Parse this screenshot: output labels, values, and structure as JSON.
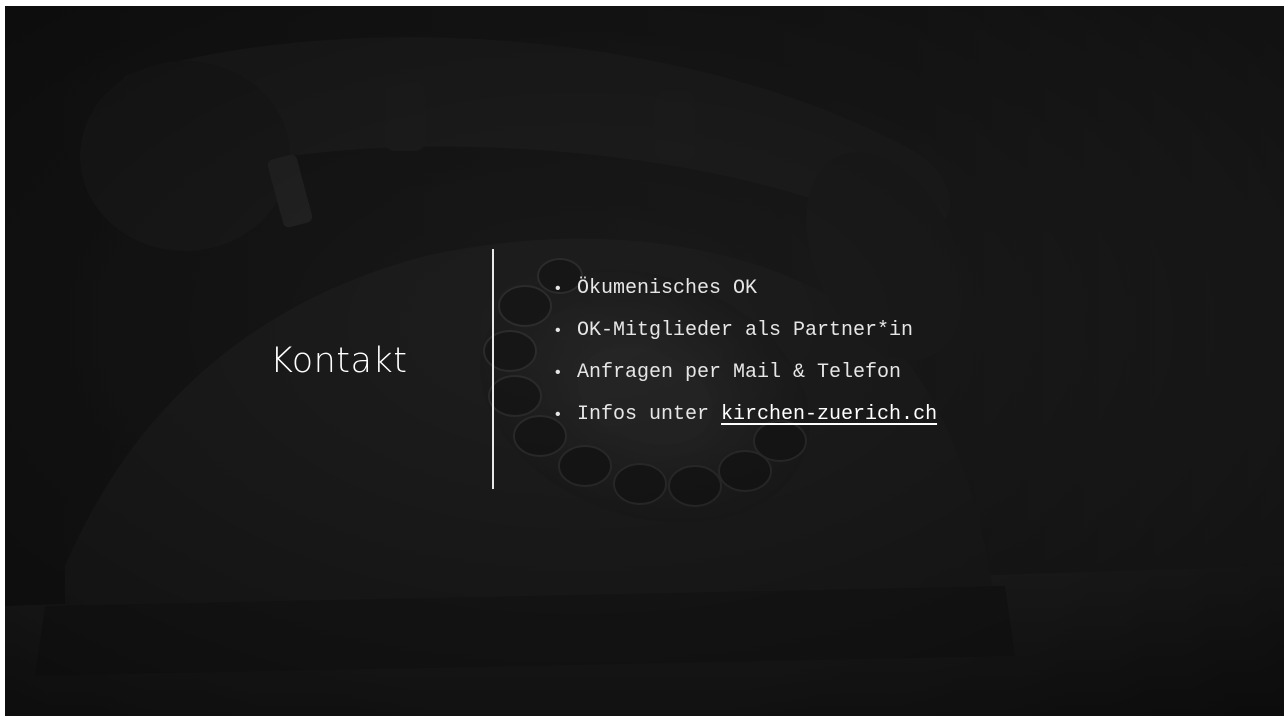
{
  "slide": {
    "title": "Kontakt",
    "bullets": [
      {
        "text": "Ökumenisches OK"
      },
      {
        "text": "OK-Mitglieder als Partner*in"
      },
      {
        "text": "Anfragen per Mail & Telefon"
      },
      {
        "prefix": "Infos unter ",
        "link_text": "kirchen-zuerich.ch"
      }
    ],
    "bullet_symbol": "•",
    "background_image": "rotary-telephone-photo"
  },
  "colors": {
    "background": "#141414",
    "text": "#e6e6e6",
    "title": "#ffffff",
    "divider": "#e8e8e8"
  }
}
